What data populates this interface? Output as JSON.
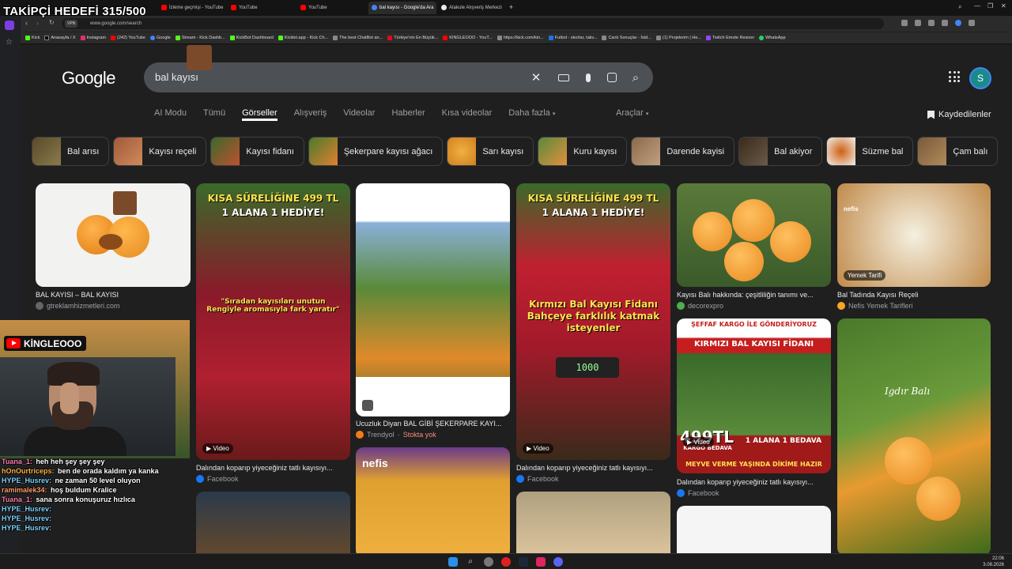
{
  "overlay": {
    "goal_text": "TAKİPÇİ HEDEFİ 315/500",
    "channel_name": "KİNGLEOOO"
  },
  "browser": {
    "tabs": [
      {
        "label": "İzleme geçmişi - YouTube",
        "color": "#ff0000"
      },
      {
        "label": "YouTube",
        "color": "#ff0000"
      },
      {
        "label": "YouTube",
        "color": "#ff0000"
      },
      {
        "label": "bal kayısı - Google'da Ara",
        "color": "#4285f4"
      },
      {
        "label": "Atakule Alışveriş Merkezi",
        "color": "#e8eaed"
      }
    ],
    "url": "www.google.com/search",
    "vpn_label": "VPN",
    "bookmarks": [
      "Kick",
      "Anasayfa / X",
      "Instagram",
      "(242) YouTube",
      "Google",
      "Stream - Kick Dashb...",
      "KickBot Dashboard",
      "Kicklet.app - Kick Ch...",
      "The best ChatBot an...",
      "Türkiye'nin En Büyük...",
      "KINGLEOOO - YouT...",
      "https://kick.com/kin...",
      "Futbol - skorlar, takv...",
      "Canlı Sonuçlar - İstd...",
      "(1) Projelerim | He...",
      "Twitch Emote Resizer",
      "WhatsApp"
    ]
  },
  "google": {
    "logo": "Google",
    "query": "bal kayısı",
    "avatar_letter": "S",
    "nav_tabs": [
      "AI Modu",
      "Tümü",
      "Görseller",
      "Alışveriş",
      "Videolar",
      "Haberler",
      "Kısa videolar",
      "Daha fazla"
    ],
    "active_tab": "Görseller",
    "tools_label": "Araçlar",
    "saved_label": "Kaydedilenler",
    "chips": [
      {
        "label": "Bal arısı",
        "color": "#6b5a3a"
      },
      {
        "label": "Kayısı reçeli",
        "color": "#a05a3a"
      },
      {
        "label": "Kayısı fidanı",
        "color": "#4a7a3a"
      },
      {
        "label": "Şekerpare kayısı ağacı",
        "color": "#c0702a"
      },
      {
        "label": "Sarı kayısı",
        "color": "#e0a030"
      },
      {
        "label": "Kuru kayısı",
        "color": "#5a8a3a"
      },
      {
        "label": "Darende kayisi",
        "color": "#8a6a4a"
      },
      {
        "label": "Bal akiyor",
        "color": "#5a4a3a"
      },
      {
        "label": "Süzme bal",
        "color": "#c05a10"
      },
      {
        "label": "Çam balı",
        "color": "#7a5a3a"
      }
    ],
    "results": [
      {
        "title": "BAL KAYISI – BAL KAYISI",
        "source": "gtreklamhizmetleri.com",
        "video": ""
      },
      {
        "title": "Dalından koparıp yiyeceğiniz tatlı kayısıyı...",
        "source": "Facebook",
        "video": "Video",
        "banner": "KISA SÜRELİĞİNE 499 TL",
        "sub": "1 ALANA 1 HEDİYE!",
        "quote": "\"Sıradan kayısıları unutun Rengiyle aromasıyla fark yaratır\""
      },
      {
        "title": "Ucuzluk Diyarı BAL GİBİ ŞEKERPARE KAYI...",
        "source": "Trendyol",
        "stock": "Stokta yok",
        "video": ""
      },
      {
        "title": "Dalından koparıp yiyeceğiniz tatlı kayısıyı...",
        "source": "Facebook",
        "video": "Video",
        "banner": "KISA SÜRELİĞİNE 499 TL",
        "sub": "1 ALANA 1 HEDİYE!",
        "quote": "Kırmızı Bal Kayısı Fidanı Bahçeye farklılık katmak isteyenler",
        "scale": "1000"
      },
      {
        "title": "Kayısı Balı hakkında: çeşitliliğin tanımı ve...",
        "source": "decorexpro",
        "video": ""
      },
      {
        "title": "Bal Tadında Kayısı Reçeli",
        "source": "Nefis Yemek Tarifleri",
        "video": "",
        "badge": "Yemek Tarifi",
        "brand": "nefis"
      },
      {
        "title": "Dalından koparıp yiyeceğiniz tatlı kayısıyı...",
        "source": "Facebook",
        "video": "Video",
        "banner": "ŞEFFAF KARGO İLE GÖNDERİYORUZ",
        "sub": "KIRMIZI BAL KAYISI FİDANI",
        "price": "499TL",
        "price_sub": "KARGO BEDAVA",
        "promo": "1 ALANA 1 BEDAVA",
        "promo2": "MEYVE VERME YAŞINDA DİKİME HAZIR"
      },
      {
        "title": "",
        "source": "",
        "video": "",
        "watermark": "Igdır Balı"
      }
    ]
  },
  "chat": [
    {
      "user": "Tuana_1:",
      "msg": " heh heh şey şey şey",
      "color": "#ff7fae"
    },
    {
      "user": "hOnOurtriceps:",
      "msg": " ben de orada kaldım ya kanka",
      "color": "#ffb347"
    },
    {
      "user": "HYPE_Husrev:",
      "msg": " ne zaman 50 level oluyon",
      "color": "#7fd4ff"
    },
    {
      "user": "ramimalek34:",
      "msg": " hoş buldum Kralice",
      "color": "#ff9e6b"
    },
    {
      "user": "Tuana_1:",
      "msg": " sana sonra konuşuruz hızlıca",
      "color": "#ff7fae"
    },
    {
      "user": "HYPE_Husrev:",
      "msg": "",
      "color": "#7fd4ff"
    },
    {
      "user": "HYPE_Husrev:",
      "msg": "",
      "color": "#7fd4ff"
    },
    {
      "user": "HYPE_Husrev:",
      "msg": "",
      "color": "#7fd4ff"
    }
  ],
  "taskbar": {
    "time": "22:06",
    "date": "3.08.2026"
  }
}
